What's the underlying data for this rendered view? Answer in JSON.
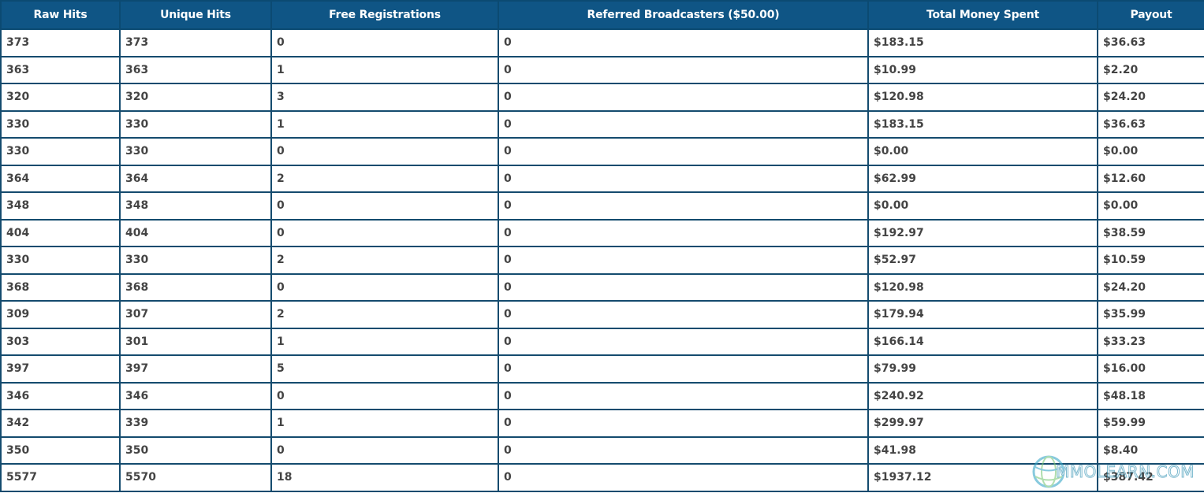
{
  "table": {
    "headers": [
      "Raw Hits",
      "Unique Hits",
      "Free Registrations",
      "Referred Broadcasters ($50.00)",
      "Total Money Spent",
      "Payout"
    ],
    "rows": [
      [
        "373",
        "373",
        "0",
        "0",
        "$183.15",
        "$36.63"
      ],
      [
        "363",
        "363",
        "1",
        "0",
        "$10.99",
        "$2.20"
      ],
      [
        "320",
        "320",
        "3",
        "0",
        "$120.98",
        "$24.20"
      ],
      [
        "330",
        "330",
        "1",
        "0",
        "$183.15",
        "$36.63"
      ],
      [
        "330",
        "330",
        "0",
        "0",
        "$0.00",
        "$0.00"
      ],
      [
        "364",
        "364",
        "2",
        "0",
        "$62.99",
        "$12.60"
      ],
      [
        "348",
        "348",
        "0",
        "0",
        "$0.00",
        "$0.00"
      ],
      [
        "404",
        "404",
        "0",
        "0",
        "$192.97",
        "$38.59"
      ],
      [
        "330",
        "330",
        "2",
        "0",
        "$52.97",
        "$10.59"
      ],
      [
        "368",
        "368",
        "0",
        "0",
        "$120.98",
        "$24.20"
      ],
      [
        "309",
        "307",
        "2",
        "0",
        "$179.94",
        "$35.99"
      ],
      [
        "303",
        "301",
        "1",
        "0",
        "$166.14",
        "$33.23"
      ],
      [
        "397",
        "397",
        "5",
        "0",
        "$79.99",
        "$16.00"
      ],
      [
        "346",
        "346",
        "0",
        "0",
        "$240.92",
        "$48.18"
      ],
      [
        "342",
        "339",
        "1",
        "0",
        "$299.97",
        "$59.99"
      ],
      [
        "350",
        "350",
        "0",
        "0",
        "$41.98",
        "$8.40"
      ],
      [
        "5577",
        "5570",
        "18",
        "0",
        "$1937.12",
        "$387.42"
      ]
    ]
  },
  "watermark": {
    "text": "MMOLEARN.COM",
    "icon": "globe-logo-icon"
  },
  "colors": {
    "header_bg": "#0f5585",
    "border": "#144b6e",
    "header_text": "#ffffff"
  }
}
